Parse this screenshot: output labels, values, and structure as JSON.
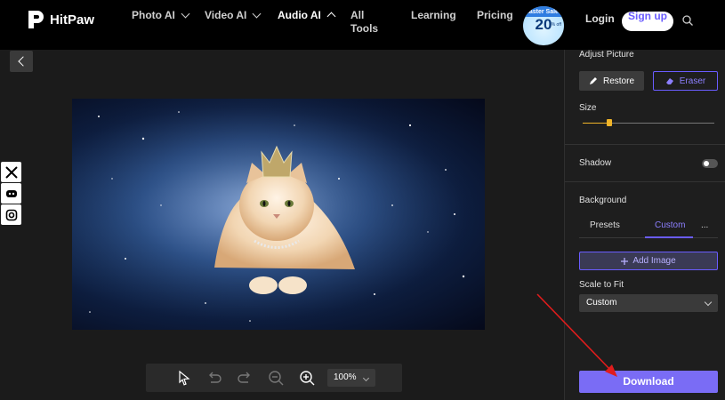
{
  "brand": {
    "name": "HitPaw"
  },
  "nav": {
    "photo_ai": "Photo AI",
    "video_ai": "Video AI",
    "audio_ai": "Audio AI",
    "all_tools": "All Tools",
    "learning": "Learning",
    "pricing": "Pricing",
    "login": "Login",
    "signup": "Sign up"
  },
  "promo": {
    "title": "Easter Sales",
    "number": "20",
    "suffix": "% off"
  },
  "toolbar": {
    "zoom": "100%"
  },
  "panel": {
    "adjust_picture": "Adjust Picture",
    "restore": "Restore",
    "eraser": "Eraser",
    "size": "Size",
    "size_value": 0.2,
    "shadow": "Shadow",
    "shadow_on": false,
    "background": "Background",
    "tabs": [
      "Presets",
      "Custom",
      "..."
    ],
    "active_tab": "Custom",
    "add_image": "Add Image",
    "scale_to_fit": "Scale to Fit",
    "scale_value": "Custom",
    "download": "Download"
  },
  "colors": {
    "accent": "#6a5cff",
    "slider": "#f0b429",
    "annotation_arrow": "#e01c1c"
  }
}
